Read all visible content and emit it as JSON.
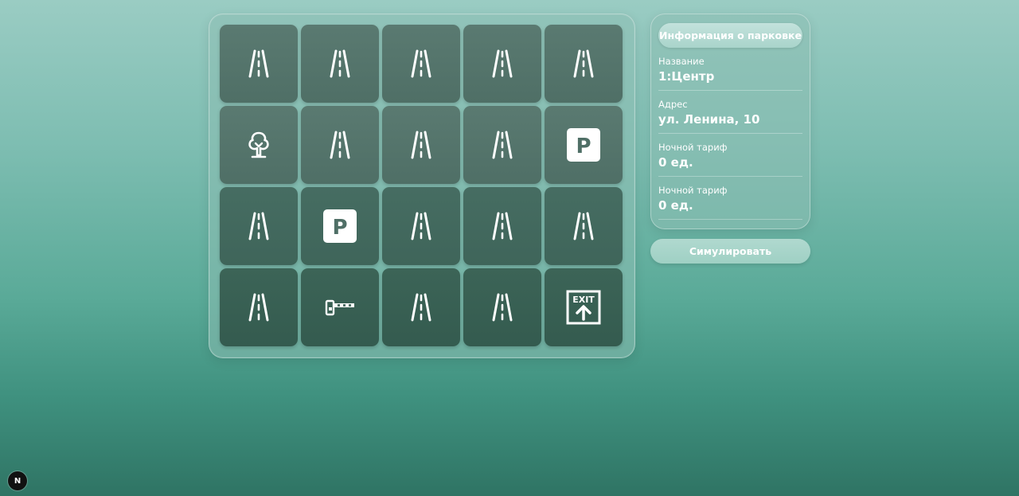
{
  "grid": {
    "cells": [
      "road",
      "road",
      "road",
      "road",
      "road",
      "tree",
      "road",
      "road",
      "road",
      "parking",
      "road",
      "parking",
      "road",
      "road",
      "road",
      "road",
      "barrier",
      "road",
      "road",
      "exit"
    ],
    "parking_letter": "P",
    "exit_label": "EXIT"
  },
  "info": {
    "header": "Информация о парковке",
    "rows": [
      {
        "label": "Название",
        "value": "1:Центр"
      },
      {
        "label": "Адрес",
        "value": "ул. Ленина, 10"
      },
      {
        "label": "Ночной тариф",
        "value": "0 ед."
      },
      {
        "label": "Ночной тариф",
        "value": "0 ед."
      }
    ]
  },
  "simulate_label": "Симулировать",
  "badge_letter": "N"
}
